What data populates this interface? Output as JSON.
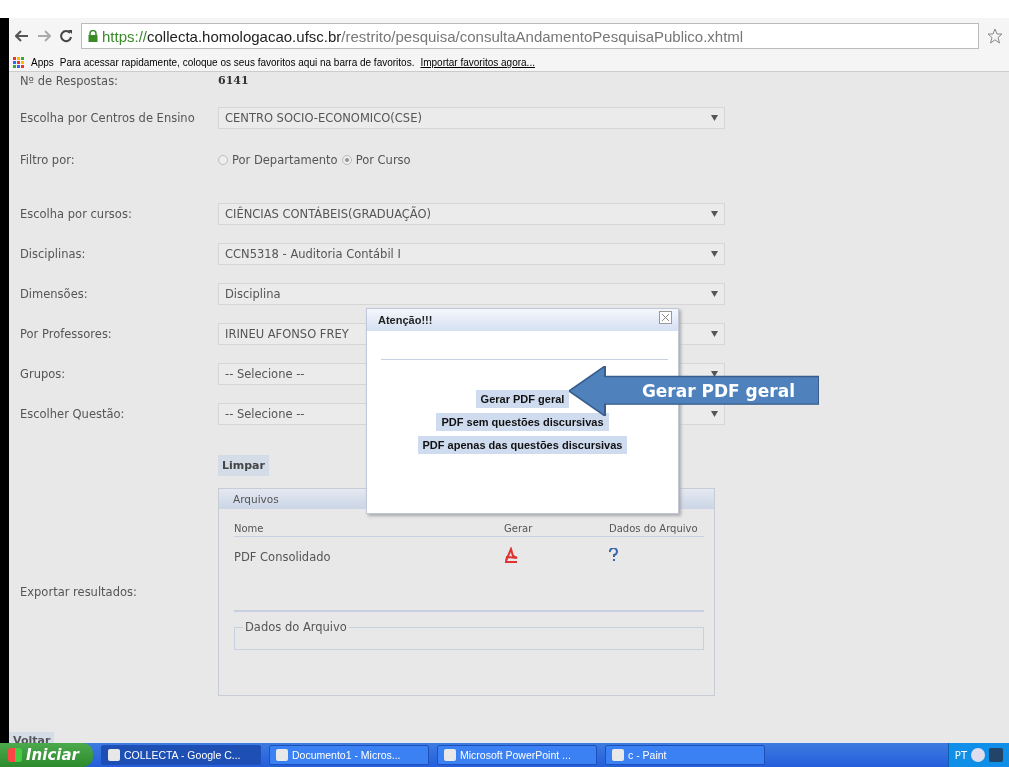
{
  "browser": {
    "url_secure": "https://",
    "url_host": "collecta.homologacao.ufsc.br",
    "url_path": "/restrito/pesquisa/consultaAndamentoPesquisaPublico.xhtml"
  },
  "bookmarks_bar": {
    "apps_label": "Apps",
    "hint": "Para acessar rapidamente, coloque os seus favoritos aqui na barra de favoritos.",
    "import_link": "Importar favoritos agora..."
  },
  "form": {
    "fields": [
      {
        "kind": "text",
        "label": "Nº de Respostas:",
        "value": "6141"
      },
      {
        "kind": "select",
        "label": "Escolha por Centros de Ensino",
        "value": "CENTRO SOCIO-ECONOMICO(CSE)"
      },
      {
        "kind": "radio",
        "label": "Filtro por:",
        "options": [
          {
            "label": "Por Departamento",
            "selected": false
          },
          {
            "label": "Por Curso",
            "selected": true
          }
        ]
      },
      {
        "kind": "select",
        "label": "Escolha por cursos:",
        "value": "CIÊNCIAS CONTÁBEIS(GRADUAÇÃO)"
      },
      {
        "kind": "select",
        "label": "Disciplinas:",
        "value": "CCN5318 - Auditoria Contábil I"
      },
      {
        "kind": "select",
        "label": "Dimensões:",
        "value": "Disciplina"
      },
      {
        "kind": "select",
        "label": "Por Professores:",
        "value": "IRINEU AFONSO FREY"
      },
      {
        "kind": "select",
        "label": "Grupos:",
        "value": "-- Selecione --"
      },
      {
        "kind": "select",
        "label": "Escolher Questão:",
        "value": "-- Selecione --"
      }
    ],
    "clear_button": "Limpar",
    "export_label": "Exportar resultados:",
    "files_panel": {
      "title": "Arquivos",
      "columns": [
        "Nome",
        "Gerar",
        "Dados do Arquivo"
      ],
      "rows": [
        {
          "name": "PDF Consolidado"
        }
      ],
      "details_legend": "Dados do Arquivo"
    },
    "back_button": "Voltar"
  },
  "dialog": {
    "title": "Atenção!!!",
    "buttons": [
      "Gerar PDF geral",
      "PDF sem questões discursivas",
      "PDF apenas das questões discursivas"
    ]
  },
  "callout": {
    "text": "Gerar PDF geral"
  },
  "taskbar": {
    "start": "Iniciar",
    "tasks": [
      "COLLECTA - Google C...",
      "Documento1 - Micros...",
      "Microsoft PowerPoint ...",
      "c - Paint"
    ],
    "language": "PT"
  }
}
